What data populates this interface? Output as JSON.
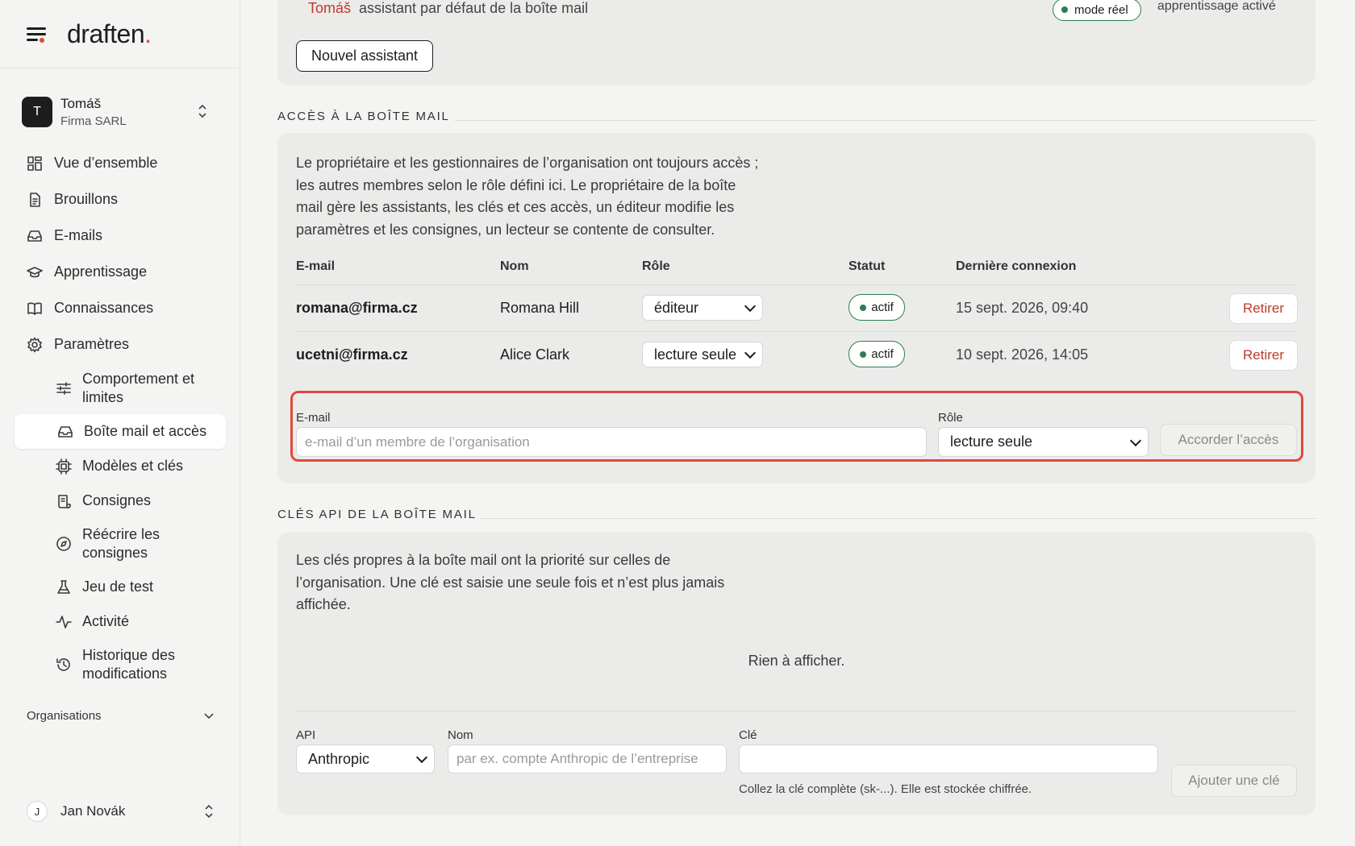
{
  "brand": {
    "logo_text": "draften",
    "logo_dot": "."
  },
  "account": {
    "initial": "T",
    "name": "Tomáš",
    "org": "Firma SARL"
  },
  "nav": {
    "overview": "Vue d’ensemble",
    "drafts": "Brouillons",
    "emails": "E-mails",
    "learning": "Apprentissage",
    "knowledge": "Connaissances",
    "settings": "Paramètres",
    "sub": {
      "behavior": "Comportement et limites",
      "mailbox": "Boîte mail et accès",
      "models": "Modèles et clés",
      "instructions": "Consignes",
      "rewrite": "Réécrire les consignes",
      "testset": "Jeu de test",
      "activity": "Activité",
      "history": "Historique des modifications"
    }
  },
  "organizations_label": "Organisations",
  "user": {
    "initial": "J",
    "name": "Jan Novák"
  },
  "assistants": {
    "row_name": "Tomáš",
    "row_desc": "assistant par défaut de la boîte mail",
    "mode_pill": "mode réel",
    "learning_status": "apprentissage activé",
    "new_button": "Nouvel assistant"
  },
  "access": {
    "section_title": "ACCÈS À LA BOÎTE MAIL",
    "description": [
      "Le propriétaire et les gestionnaires de l’organisation ont toujours accès ;",
      "les autres membres selon le rôle défini ici. Le propriétaire de la boîte",
      "mail gère les assistants, les clés et ces accès, un éditeur modifie les",
      "paramètres et les consignes, un lecteur se contente de consulter."
    ],
    "columns": {
      "email": "E-mail",
      "name": "Nom",
      "role": "Rôle",
      "status": "Statut",
      "last_login": "Dernière connexion"
    },
    "rows": [
      {
        "email": "romana@firma.cz",
        "name": "Romana Hill",
        "role": "éditeur",
        "status": "actif",
        "last_login": "15 sept. 2026, 09:40",
        "action": "Retirer"
      },
      {
        "email": "ucetni@firma.cz",
        "name": "Alice Clark",
        "role": "lecture seule",
        "status": "actif",
        "last_login": "10 sept. 2026, 14:05",
        "action": "Retirer"
      }
    ],
    "form": {
      "email_label": "E-mail",
      "email_placeholder": "e-mail d’un membre de l’organisation",
      "role_label": "Rôle",
      "role_value": "lecture seule",
      "submit": "Accorder l’accès"
    }
  },
  "api_keys": {
    "section_title": "CLÉS API DE LA BOÎTE MAIL",
    "description": [
      "Les clés propres à la boîte mail ont la priorité sur celles de",
      "l’organisation. Une clé est saisie une seule fois et n’est plus jamais",
      "affichée."
    ],
    "empty": "Rien à afficher.",
    "form": {
      "api_label": "API",
      "api_value": "Anthropic",
      "name_label": "Nom",
      "name_placeholder": "par ex. compte Anthropic de l’entreprise",
      "key_label": "Clé",
      "key_hint": "Collez la clé complète (sk-...). Elle est stockée chiffrée.",
      "submit": "Ajouter une clé"
    }
  },
  "colors": {
    "accent": "#e0493a",
    "status_green": "#2e7d4f",
    "danger": "#c0392b"
  }
}
